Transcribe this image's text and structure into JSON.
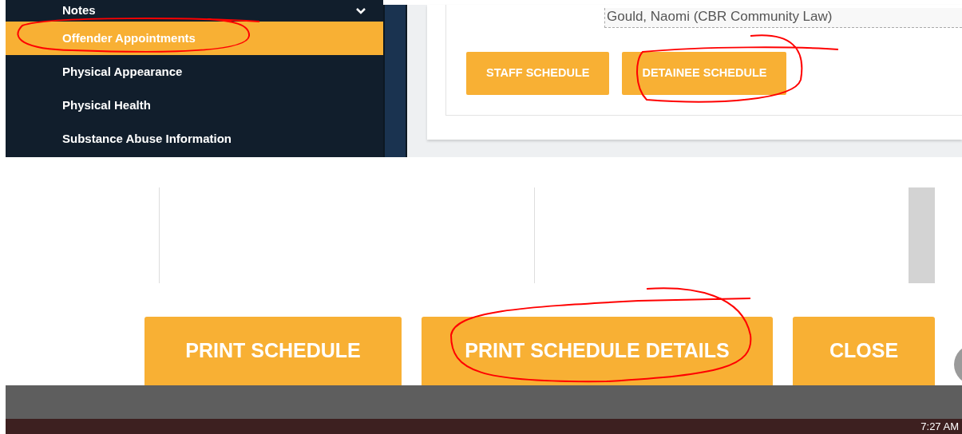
{
  "sidebar": {
    "items": [
      {
        "label": "Notes",
        "selected": false,
        "kind": "group"
      },
      {
        "label": "Offender Appointments",
        "selected": true,
        "kind": "link"
      },
      {
        "label": "Physical Appearance",
        "selected": false,
        "kind": "link"
      },
      {
        "label": "Physical Health",
        "selected": false,
        "kind": "link"
      },
      {
        "label": "Substance Abuse Information",
        "selected": false,
        "kind": "link"
      }
    ]
  },
  "attendees_field": {
    "value": "Gould, Naomi (CBR Community Law)"
  },
  "schedule_buttons": [
    "STAFF SCHEDULE",
    "DETAINEE SCHEDULE"
  ],
  "dialog_buttons": [
    "PRINT SCHEDULE",
    "PRINT SCHEDULE DETAILS",
    "CLOSE"
  ],
  "taskbar": {
    "time": "7:27 AM"
  },
  "annotations": [
    {
      "kind": "freehand-circle"
    },
    {
      "kind": "freehand-circle"
    },
    {
      "kind": "freehand-circle"
    }
  ]
}
